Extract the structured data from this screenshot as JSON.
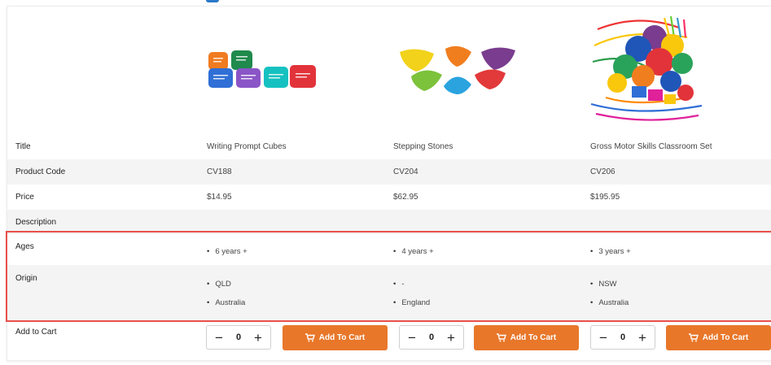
{
  "headers": {
    "title": "Title",
    "product_code": "Product Code",
    "price": "Price",
    "description": "Description",
    "ages": "Ages",
    "origin": "Origin",
    "add_to_cart": "Add to Cart"
  },
  "products": [
    {
      "image": "writing-prompt-cubes-image",
      "title": "Writing Prompt Cubes",
      "code": "CV188",
      "price": "$14.95",
      "ages": [
        "6 years +"
      ],
      "origin": [
        "QLD",
        "Australia"
      ],
      "quantity": "0"
    },
    {
      "image": "stepping-stones-image",
      "title": "Stepping Stones",
      "code": "CV204",
      "price": "$62.95",
      "ages": [
        "4 years +"
      ],
      "origin": [
        "-",
        "England"
      ],
      "quantity": "0"
    },
    {
      "image": "gross-motor-skills-set-image",
      "title": "Gross Motor Skills Classroom Set",
      "code": "CV206",
      "price": "$195.95",
      "ages": [
        "3 years +"
      ],
      "origin": [
        "NSW",
        "Australia"
      ],
      "quantity": "0"
    }
  ],
  "cart": {
    "button_label": "Add To Cart",
    "minus": "−",
    "plus": "+"
  },
  "colors": {
    "accent": "#e8772a",
    "highlight": "#e8504a",
    "row_shade": "#f4f4f4"
  }
}
